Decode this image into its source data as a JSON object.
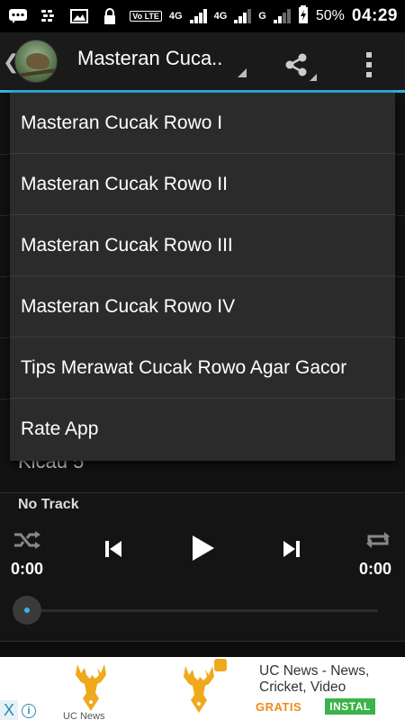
{
  "status_bar": {
    "network_volte": "Vo LTE",
    "network_4g": "4G",
    "network_4g_2": "4G",
    "network_g": "G",
    "battery_percent": "50%",
    "time": "04:29",
    "left_icons": [
      "chat-icon",
      "bbm-icon",
      "image-icon",
      "lock-icon"
    ]
  },
  "action_bar": {
    "title": "Masteran Cuca..",
    "share_icon": "share-icon",
    "overflow_icon": "overflow-menu-icon",
    "accent_color": "#33b5e5"
  },
  "dropdown": {
    "items": [
      "Masteran Cucak Rowo I",
      "Masteran Cucak Rowo II",
      "Masteran Cucak Rowo III",
      "Masteran Cucak Rowo IV",
      "Tips Merawat Cucak Rowo Agar Gacor",
      "Rate App"
    ]
  },
  "background_list": {
    "peek_item": "Kicau 5"
  },
  "player": {
    "track_label": "No Track",
    "elapsed": "0:00",
    "duration": "0:00",
    "progress": 0,
    "icons": [
      "shuffle-icon",
      "previous-icon",
      "play-icon",
      "next-icon",
      "repeat-icon"
    ]
  },
  "ad": {
    "title": "UC News - News, Cricket, Video",
    "free_label": "GRATIS",
    "install_label": "INSTAL",
    "small_label": "UC News",
    "close_label": "X"
  }
}
